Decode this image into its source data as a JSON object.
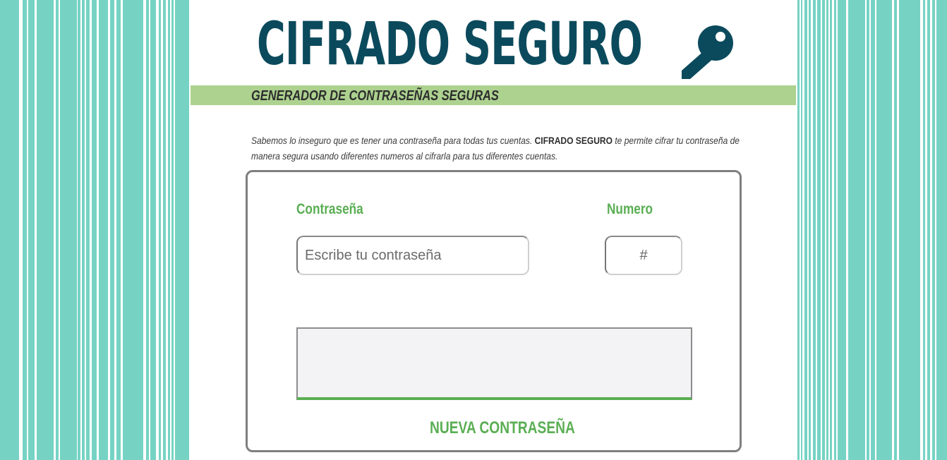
{
  "header": {
    "title": "CIFRADO SEGURO",
    "icon": "key-icon",
    "subtitle": "GENERADOR DE CONTRASEÑAS SEGURAS"
  },
  "intro": {
    "part1": "Sabemos lo inseguro que es tener una contraseña para todas tus cuentas. ",
    "brand": "CIFRADO SEGURO",
    "part2": " te permite cifrar tu contraseña de manera segura usando diferentes numeros al cifrarla para tus diferentes cuentas."
  },
  "form": {
    "password_label": "Contraseña",
    "password_placeholder": "Escribe tu contraseña",
    "password_value": "",
    "number_label": "Numero",
    "number_placeholder": "#",
    "number_value": "",
    "result_value": "",
    "submit_label": "NUEVA CONTRASEÑA"
  },
  "colors": {
    "title": "#0b4a5c",
    "accent_green": "#5aae53",
    "subtitle_bar": "#add28f",
    "stripe": "#76d3c4"
  }
}
